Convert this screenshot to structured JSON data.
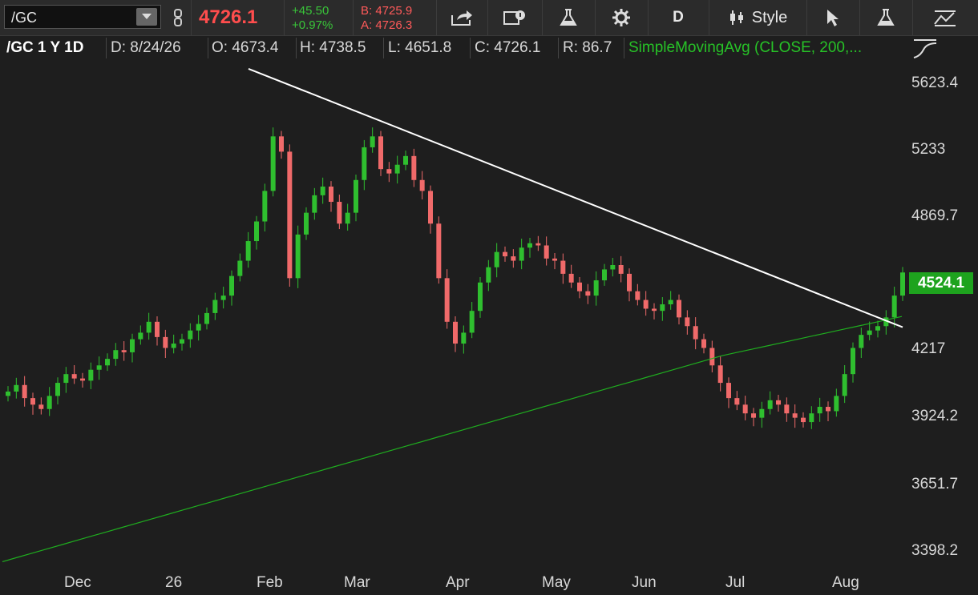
{
  "toolbar": {
    "symbol": "/GC",
    "last_price": "4726.1",
    "change_abs": "+45.50",
    "change_pct": "+0.97%",
    "bid": "B: 4725.9",
    "ask": "A: 4726.3",
    "period": "D",
    "style_label": "Style"
  },
  "infobar": {
    "symbol": "/GC 1 Y 1D",
    "date": "D: 8/24/26",
    "open": "O: 4673.4",
    "high": "H: 4738.5",
    "low": "L: 4651.8",
    "close": "C: 4726.1",
    "range": "R: 86.7",
    "study": "SimpleMovingAvg (CLOSE, 200,..."
  },
  "price_tag": "4524.1",
  "colors": {
    "up": "#2fbf2f",
    "down": "#f06a6a",
    "sma": "#1fae1f",
    "trendline": "#ffffff",
    "background": "#1e1e1e"
  },
  "chart_data": {
    "type": "candlestick",
    "x_labels": [
      "Dec",
      "26",
      "Feb",
      "Mar",
      "Apr",
      "May",
      "Jun",
      "Jul",
      "Aug"
    ],
    "y_ticks": [
      "5623.4",
      "5233",
      "4869.7",
      "4524.1",
      "4217",
      "3924.2",
      "3651.7",
      "3398.2"
    ],
    "series": [
      {
        "name": "/GC",
        "ohlc_closes_approx": [
          4180,
          4210,
          4150,
          4120,
          4100,
          4160,
          4220,
          4260,
          4240,
          4230,
          4280,
          4300,
          4330,
          4370,
          4360,
          4420,
          4450,
          4500,
          4430,
          4380,
          4400,
          4420,
          4460,
          4490,
          4540,
          4600,
          4620,
          4710,
          4780,
          4870,
          4960,
          5100,
          5350,
          5280,
          4700,
          4900,
          5000,
          5080,
          5120,
          5050,
          4950,
          5000,
          5150,
          5300,
          5350,
          5200,
          5180,
          5220,
          5260,
          5150,
          5100,
          4950,
          4700,
          4500,
          4400,
          4450,
          4550,
          4680,
          4750,
          4820,
          4800,
          4780,
          4840,
          4860,
          4850,
          4790,
          4780,
          4720,
          4680,
          4640,
          4620,
          4690,
          4740,
          4760,
          4720,
          4640,
          4600,
          4560,
          4550,
          4580,
          4600,
          4520,
          4480,
          4420,
          4380,
          4300,
          4220,
          4150,
          4120,
          4080,
          4060,
          4100,
          4140,
          4120,
          4080,
          4060,
          4040,
          4080,
          4110,
          4090,
          4160,
          4260,
          4380,
          4440,
          4460,
          4480,
          4520,
          4620,
          4726.1
        ]
      },
      {
        "name": "SimpleMovingAvg (CLOSE, 200)",
        "start": 3400,
        "end": 4524.1
      }
    ],
    "trendline": {
      "from_value": 5660,
      "to_value": 4475
    },
    "y_range": [
      3350,
      5700
    ]
  }
}
